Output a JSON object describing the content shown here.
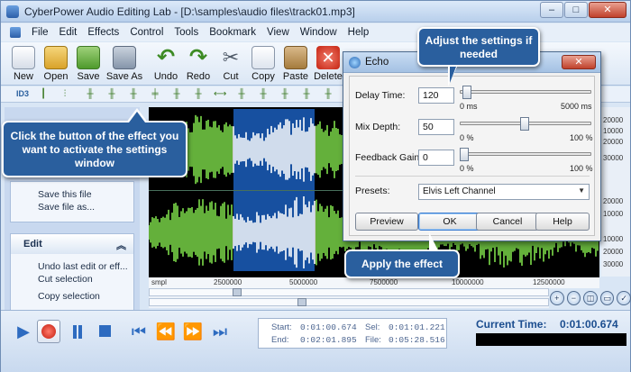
{
  "window": {
    "title": "CyberPower Audio Editing Lab - [D:\\samples\\audio files\\track01.mp3]",
    "controls": {
      "minimize": "–",
      "maximize": "□",
      "close": "✕"
    }
  },
  "menu": [
    "File",
    "Edit",
    "Effects",
    "Control",
    "Tools",
    "Bookmark",
    "View",
    "Window",
    "Help"
  ],
  "toolbar": {
    "new": "New",
    "open": "Open",
    "save": "Save",
    "save_as": "Save As",
    "undo": "Undo",
    "redo": "Redo",
    "cut": "Cut",
    "copy": "Copy",
    "paste": "Paste",
    "delete": "Delete"
  },
  "effects_bar": {
    "id3": "ID3"
  },
  "left_panel": {
    "file_links": [
      "Save this file",
      "Save file as..."
    ],
    "edit_header": "Edit",
    "edit_links": [
      "Undo last edit or eff...",
      "Cut selection",
      "Copy selection"
    ]
  },
  "ruler": {
    "labels": [
      "smpl",
      "2500000",
      "5000000",
      "7500000",
      "10000000",
      "12500000"
    ]
  },
  "scale": {
    "labels": [
      "20000",
      "10000",
      "20000",
      "30000",
      "20000",
      "10000",
      "10000",
      "20000",
      "30000"
    ]
  },
  "echo_dialog": {
    "title": "Echo",
    "close": "✕",
    "delay_label": "Delay Time:",
    "delay_value": "120",
    "delay_level": 0.02,
    "delay_min": "0 ms",
    "delay_max": "5000 ms",
    "mix_label": "Mix Depth:",
    "mix_value": "50",
    "mix_level": 0.5,
    "mix_min": "0 %",
    "mix_max": "100 %",
    "feedback_label": "Feedback Gain:",
    "feedback_value": "0",
    "feedback_level": 0.0,
    "feedback_min": "0 %",
    "feedback_max": "100 %",
    "presets_label": "Presets:",
    "preset_value": "Elvis Left Channel",
    "preview": "Preview",
    "ok": "OK",
    "cancel": "Cancel",
    "help": "Help"
  },
  "callouts": {
    "adjust": "Adjust the settings if needed",
    "click_effect": "Click the button of the effect you want to activate the settings window",
    "apply": "Apply the effect"
  },
  "status": {
    "start_label": "Start:",
    "start_value": "0:01:00.674",
    "end_label": "End:",
    "end_value": "0:02:01.895",
    "sel_label": "Sel:",
    "sel_value": "0:01:01.221",
    "file_label": "File:",
    "file_value": "0:05:28.516",
    "current_time_label": "Current Time:",
    "current_time_value": "0:01:00.674"
  },
  "colors": {
    "waveform": "#7ddc4a",
    "selection": "#1750a0",
    "selected_waveform": "#ffffff",
    "callout": "#2a5f9e"
  }
}
